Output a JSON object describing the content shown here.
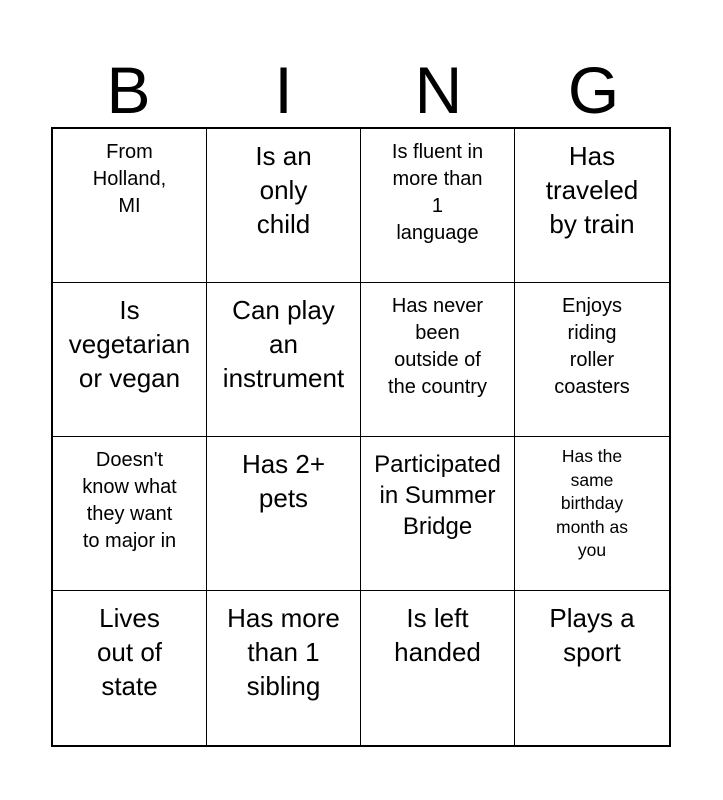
{
  "header": {
    "letters": [
      "B",
      "I",
      "N",
      "G"
    ]
  },
  "card": {
    "cells": [
      [
        "From\nHolland,\nMI",
        "Is an\nonly\nchild",
        "Is fluent in\nmore than\n1\nlanguage",
        "Has\ntraveled\nby train"
      ],
      [
        "Is\nvegetarian\nor vegan",
        "Can play\nan\ninstrument",
        "Has never\nbeen\noutside of\nthe country",
        "Enjoys\nriding\nroller\ncoasters"
      ],
      [
        "Doesn't\nknow what\nthey want\nto major in",
        "Has 2+\npets",
        "Participated\nin Summer\nBridge",
        "Has the\nsame\nbirthday\nmonth as\nyou"
      ],
      [
        "Lives\nout of\nstate",
        "Has more\nthan 1\nsibling",
        "Is left\nhanded",
        "Plays a\nsport"
      ]
    ]
  }
}
